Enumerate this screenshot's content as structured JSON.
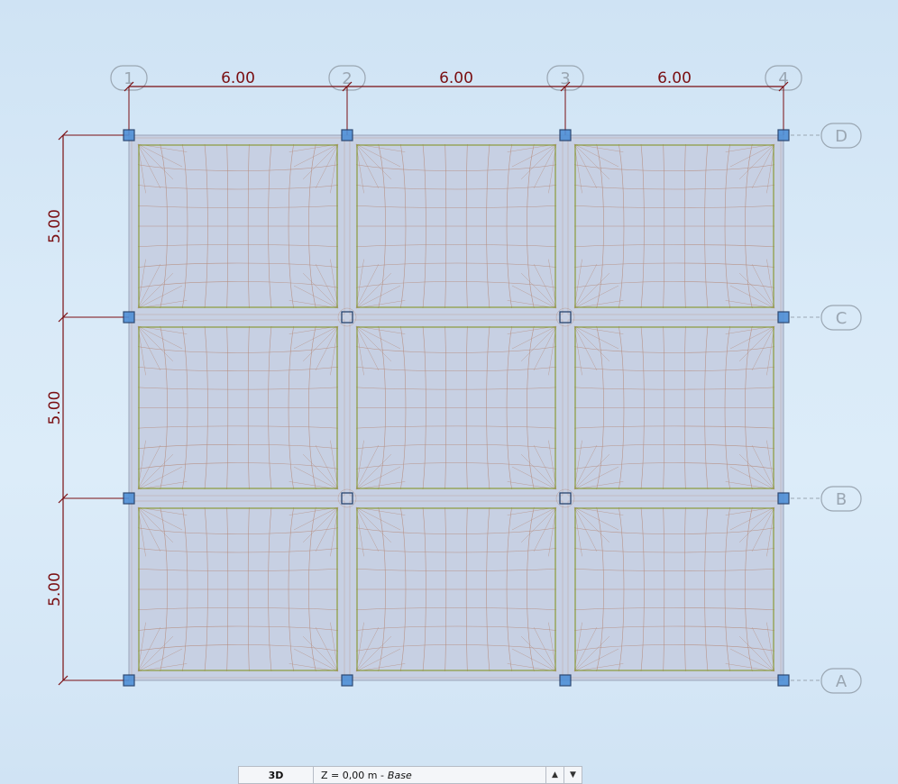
{
  "grid": {
    "columns": [
      {
        "label": "1"
      },
      {
        "label": "2"
      },
      {
        "label": "3"
      },
      {
        "label": "4"
      }
    ],
    "rows": [
      {
        "label": "D"
      },
      {
        "label": "C"
      },
      {
        "label": "B"
      },
      {
        "label": "A"
      }
    ],
    "column_spacings": [
      "6.00",
      "6.00",
      "6.00"
    ],
    "row_spacings": [
      "5.00",
      "5.00",
      "5.00"
    ]
  },
  "colors": {
    "dimension": "#7a0f12",
    "slab_fill": "#c7d0e3",
    "mesh": "#b58a7a",
    "beam": "#8b9a3a",
    "column_fill": "#4f8fd6",
    "column_stroke": "#1d3a66",
    "axis_bubble": "#9aa6b2"
  },
  "statusbar": {
    "view_label": "3D",
    "level_label": "Z = 0,00 m -",
    "story_label": "Base",
    "up_icon": "triangle-up-icon",
    "down_icon": "triangle-down-icon"
  }
}
